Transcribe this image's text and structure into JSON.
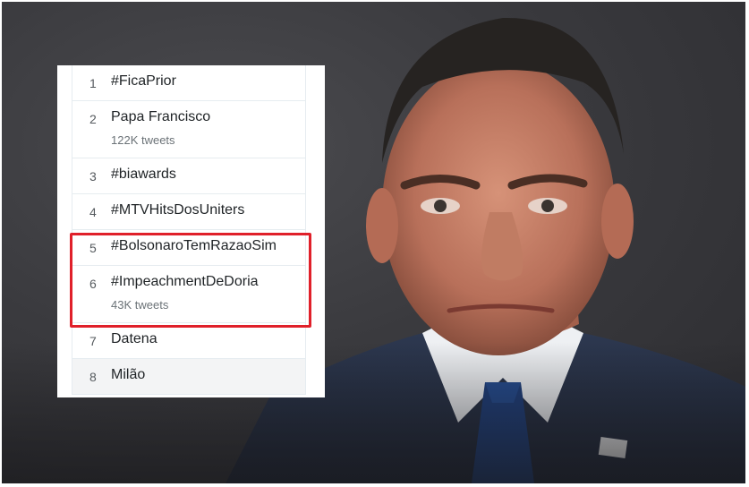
{
  "trends": [
    {
      "rank": "1",
      "name": "#FicaPrior",
      "count": ""
    },
    {
      "rank": "2",
      "name": "Papa Francisco",
      "count": "122K tweets"
    },
    {
      "rank": "3",
      "name": "#biawards",
      "count": ""
    },
    {
      "rank": "4",
      "name": "#MTVHitsDosUniters",
      "count": ""
    },
    {
      "rank": "5",
      "name": "#BolsonaroTemRazaoSim",
      "count": ""
    },
    {
      "rank": "6",
      "name": "#ImpeachmentDeDoria",
      "count": "43K tweets"
    },
    {
      "rank": "7",
      "name": "Datena",
      "count": ""
    },
    {
      "rank": "8",
      "name": "Milão",
      "count": ""
    }
  ],
  "colors": {
    "highlight": "#e0202a",
    "background": "#3a3a3e",
    "panel": "#ffffff"
  }
}
